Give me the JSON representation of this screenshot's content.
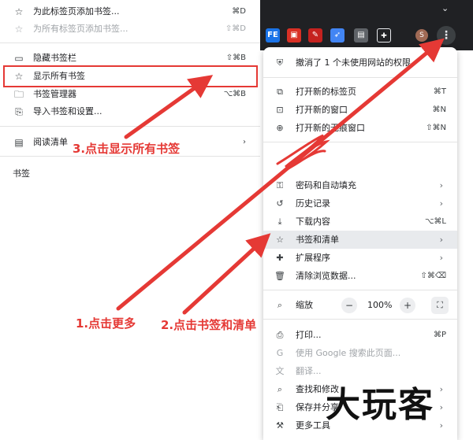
{
  "bookmarks_submenu": {
    "items": [
      {
        "label": "为此标签页添加书签...",
        "shortcut": "⌘D",
        "icon": "star-icon",
        "dim": false
      },
      {
        "label": "为所有标签页添加书签...",
        "shortcut": "⇧⌘D",
        "icon": "star-icon",
        "dim": true
      },
      {
        "label": "隐藏书签栏",
        "shortcut": "⇧⌘B",
        "icon": "bookmark-bar-icon",
        "dim": false
      },
      {
        "label": "显示所有书签",
        "shortcut": "",
        "icon": "star-icon",
        "dim": false
      },
      {
        "label": "书签管理器",
        "shortcut": "⌥⌘B",
        "icon": "folder-icon",
        "dim": false
      },
      {
        "label": "导入书签和设置...",
        "shortcut": "",
        "icon": "import-icon",
        "dim": false
      }
    ],
    "reading_list_label": "阅读清单",
    "bookmarks_section_label": "书签"
  },
  "toolbar": {
    "extension_icons": [
      {
        "name": "fe-extension-icon",
        "text": "FE",
        "color": "#1a73e8"
      },
      {
        "name": "reader-extension-icon",
        "text": "📖",
        "color": "#d93025"
      },
      {
        "name": "pen-extension-icon",
        "text": "✎",
        "color": "#c5221f"
      },
      {
        "name": "bird-extension-icon",
        "text": "✈",
        "color": "#4285f4"
      },
      {
        "name": "card-extension-icon",
        "text": "▤",
        "color": "#5f6368"
      },
      {
        "name": "puzzle-icon",
        "text": "⧉",
        "color": "#202124"
      }
    ],
    "avatar_letter": "S",
    "more_label": "⋮"
  },
  "chrome_menu": {
    "notice": "撤消了 1 个未使用网站的权限",
    "items": [
      {
        "label": "打开新的标签页",
        "shortcut": "⌘T",
        "icon": "new-tab-icon"
      },
      {
        "label": "打开新的窗口",
        "shortcut": "⌘N",
        "icon": "new-window-icon"
      },
      {
        "label": "打开新的无痕窗口",
        "shortcut": "⇧⌘N",
        "icon": "incognito-icon"
      }
    ],
    "items2": [
      {
        "label": "密码和自动填充",
        "icon": "key-icon",
        "arrow": true
      },
      {
        "label": "历史记录",
        "icon": "history-icon",
        "arrow": true
      },
      {
        "label": "下载内容",
        "icon": "download-icon",
        "shortcut": "⌥⌘L"
      },
      {
        "label": "书签和清单",
        "icon": "star-icon",
        "arrow": true,
        "highlight": true
      },
      {
        "label": "扩展程序",
        "icon": "extension-icon",
        "arrow": true
      },
      {
        "label": "清除浏览数据...",
        "icon": "trash-icon",
        "shortcut": "⇧⌘⌫"
      }
    ],
    "zoom": {
      "label": "缩放",
      "value": "100%",
      "minus": "−",
      "plus": "+"
    },
    "items3": [
      {
        "label": "打印...",
        "icon": "print-icon",
        "shortcut": "⌘P"
      },
      {
        "label": "使用 Google 搜索此页面...",
        "icon": "google-icon",
        "dim": true
      },
      {
        "label": "翻译...",
        "icon": "translate-icon",
        "dim": true
      },
      {
        "label": "查找和修改",
        "icon": "find-icon",
        "arrow": true
      },
      {
        "label": "保存并分享",
        "icon": "save-icon",
        "arrow": true
      },
      {
        "label": "更多工具",
        "icon": "tools-icon",
        "arrow": true
      }
    ]
  },
  "annotations": {
    "step1": "1.点击更多",
    "step2": "2.点击书签和清单",
    "step3": "3.点击显示所有书签",
    "color": "#e53935"
  },
  "watermark": "大玩客"
}
